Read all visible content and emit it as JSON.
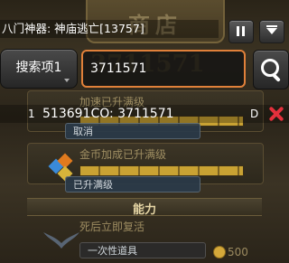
{
  "header": {
    "title": "八门神器: 神庙逃亡[13757]"
  },
  "background": {
    "shop_title": "商店",
    "gold_display": "3711571",
    "rows": [
      {
        "label": "加速已升满级",
        "button": "取消"
      },
      {
        "label": "金币加成已升满级",
        "button": "已升满级"
      }
    ],
    "section_title": "能力",
    "items": [
      {
        "label": "死后立即复活"
      },
      {
        "label": "一次性道具"
      }
    ],
    "price": "500"
  },
  "search": {
    "dropdown_label": "搜索项1",
    "input_value": "3711571"
  },
  "results": [
    {
      "index": "1",
      "text": "513691CO: 3711571",
      "type": "D"
    }
  ],
  "colors": {
    "input_border": "#e0803a",
    "delete": "#e3303c"
  }
}
